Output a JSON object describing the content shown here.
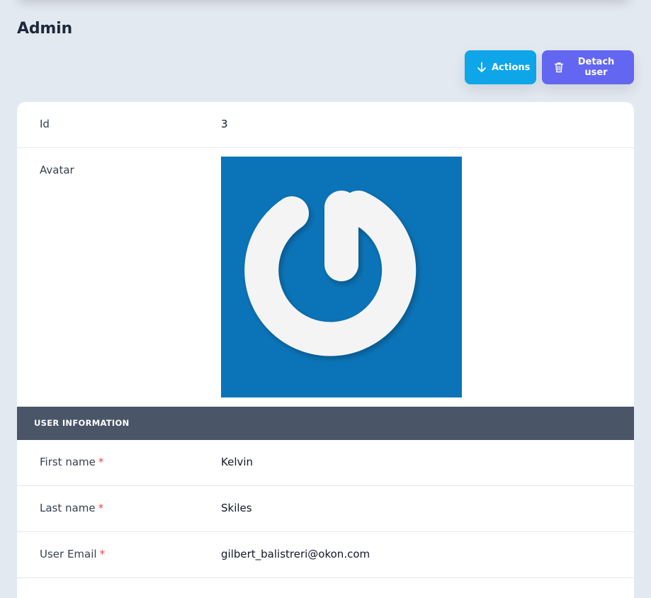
{
  "page": {
    "title": "Admin"
  },
  "toolbar": {
    "actions_label": "Actions",
    "detach_label": "Detach user"
  },
  "record": {
    "id_label": "Id",
    "id_value": "3",
    "avatar_label": "Avatar"
  },
  "section": {
    "title": "USER INFORMATION"
  },
  "fields": [
    {
      "label": "First name",
      "required_mark": "*",
      "value": "Kelvin"
    },
    {
      "label": "Last name",
      "required_mark": "*",
      "value": "Skiles"
    },
    {
      "label": "User Email",
      "required_mark": "*",
      "value": "gilbert_balistreri@okon.com"
    }
  ],
  "colors": {
    "actions_button": "#0ea5e9",
    "detach_button": "#6366f1",
    "section_header": "#4a5568",
    "avatar_background": "#0b74b8",
    "required_mark": "#ef4444"
  },
  "icons": {
    "actions": "arrow-down-icon",
    "detach": "trash-icon",
    "avatar": "power-logo"
  }
}
